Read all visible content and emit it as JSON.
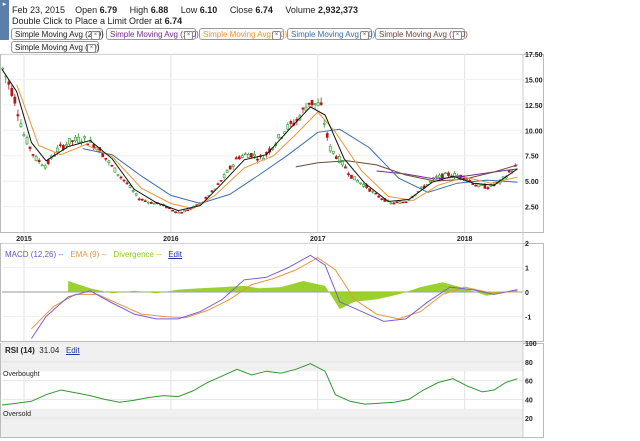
{
  "quote": {
    "date": "Feb 23, 2015",
    "open_label": "Open",
    "open": "6.79",
    "high_label": "High",
    "high": "6.88",
    "low_label": "Low",
    "low": "6.10",
    "close_label": "Close",
    "close": "6.74",
    "volume_label": "Volume",
    "volume": "2,932,373",
    "limit_order_text": "Double Click to Place a Limit Order at",
    "limit_order_price": "6.74"
  },
  "moving_averages": [
    {
      "label": "Simple Moving Avg (200)",
      "color": "#333333"
    },
    {
      "label": "Simple Moving Avg (150)",
      "color": "#7a2b9a"
    },
    {
      "label": "Simple Moving Avg (20)",
      "color": "#e8963c"
    },
    {
      "label": "Simple Moving Avg (50)",
      "color": "#3a6fb0"
    },
    {
      "label": "Simple Moving Avg (100)",
      "color": "#6b4a3a"
    },
    {
      "label": "Simple Moving Avg (10)",
      "color": "#222222"
    }
  ],
  "colors": {
    "up_candle": "#2e9a2e",
    "down_candle": "#b01818",
    "sma10": "#111111",
    "sma20": "#e8963c",
    "sma50": "#3a6fb0",
    "sma100": "#6b4a3a",
    "sma150": "#7a2b9a",
    "macd_line": "#7a5fd6",
    "macd_ema": "#e8963c",
    "macd_divergence": "#8fcc1a",
    "rsi_line": "#2e9a2e",
    "side_toggle": "#5b7fa8"
  },
  "panels": {
    "macd": {
      "label": "MACD (12,26)",
      "ema_label": "EMA (9)",
      "divergence_label": "Divergence",
      "edit": "Edit",
      "value_placeholder": "--"
    },
    "rsi": {
      "label": "RSI (14)",
      "value": "31.04",
      "edit": "Edit",
      "overbought": "Overbought",
      "oversold": "Oversold"
    }
  },
  "chart_data": [
    {
      "type": "candlestick",
      "title": "",
      "x_ticks": [
        "2015",
        "2016",
        "2017",
        "2018"
      ],
      "y_ticks": [
        "17.50",
        "15.00",
        "12.50",
        "10.00",
        "7.50",
        "5.00",
        "2.50"
      ],
      "ylim": [
        0,
        17.5
      ],
      "price_path": [
        [
          2014.85,
          16.2
        ],
        [
          2014.93,
          13.5
        ],
        [
          2015.0,
          9.5
        ],
        [
          2015.08,
          7.2
        ],
        [
          2015.15,
          6.5
        ],
        [
          2015.22,
          8.0
        ],
        [
          2015.3,
          8.8
        ],
        [
          2015.4,
          9.2
        ],
        [
          2015.5,
          8.4
        ],
        [
          2015.6,
          6.4
        ],
        [
          2015.7,
          4.8
        ],
        [
          2015.78,
          3.3
        ],
        [
          2015.86,
          2.9
        ],
        [
          2015.94,
          2.7
        ],
        [
          2016.0,
          2.2
        ],
        [
          2016.06,
          1.9
        ],
        [
          2016.14,
          2.3
        ],
        [
          2016.22,
          3.0
        ],
        [
          2016.3,
          4.2
        ],
        [
          2016.38,
          5.8
        ],
        [
          2016.46,
          7.4
        ],
        [
          2016.54,
          7.7
        ],
        [
          2016.62,
          7.2
        ],
        [
          2016.7,
          8.6
        ],
        [
          2016.78,
          10.1
        ],
        [
          2016.86,
          11.0
        ],
        [
          2016.94,
          12.8
        ],
        [
          2017.02,
          12.4
        ],
        [
          2017.08,
          8.3
        ],
        [
          2017.16,
          6.9
        ],
        [
          2017.24,
          5.3
        ],
        [
          2017.32,
          4.6
        ],
        [
          2017.4,
          3.6
        ],
        [
          2017.5,
          2.8
        ],
        [
          2017.6,
          3.0
        ],
        [
          2017.7,
          4.2
        ],
        [
          2017.8,
          5.3
        ],
        [
          2017.9,
          5.7
        ],
        [
          2018.0,
          5.4
        ],
        [
          2018.08,
          4.6
        ],
        [
          2018.16,
          4.4
        ],
        [
          2018.24,
          4.9
        ],
        [
          2018.3,
          5.8
        ],
        [
          2018.36,
          6.6
        ]
      ],
      "sma10": [
        [
          2014.85,
          16.0
        ],
        [
          2014.95,
          13.8
        ],
        [
          2015.05,
          8.8
        ],
        [
          2015.15,
          7.0
        ],
        [
          2015.3,
          8.4
        ],
        [
          2015.45,
          9.0
        ],
        [
          2015.6,
          7.2
        ],
        [
          2015.75,
          4.2
        ],
        [
          2015.9,
          2.9
        ],
        [
          2016.05,
          2.1
        ],
        [
          2016.2,
          2.6
        ],
        [
          2016.35,
          4.8
        ],
        [
          2016.5,
          7.1
        ],
        [
          2016.65,
          7.6
        ],
        [
          2016.8,
          10.0
        ],
        [
          2016.95,
          12.3
        ],
        [
          2017.05,
          11.5
        ],
        [
          2017.18,
          7.2
        ],
        [
          2017.32,
          4.8
        ],
        [
          2017.48,
          3.0
        ],
        [
          2017.62,
          3.2
        ],
        [
          2017.78,
          4.9
        ],
        [
          2017.92,
          5.5
        ],
        [
          2018.06,
          4.8
        ],
        [
          2018.2,
          4.6
        ],
        [
          2018.36,
          6.2
        ]
      ],
      "sma20": [
        [
          2014.95,
          14.5
        ],
        [
          2015.1,
          8.5
        ],
        [
          2015.25,
          7.6
        ],
        [
          2015.42,
          8.6
        ],
        [
          2015.6,
          7.4
        ],
        [
          2015.8,
          4.3
        ],
        [
          2016.0,
          2.8
        ],
        [
          2016.15,
          2.3
        ],
        [
          2016.3,
          3.6
        ],
        [
          2016.5,
          6.3
        ],
        [
          2016.7,
          7.5
        ],
        [
          2016.85,
          9.6
        ],
        [
          2017.0,
          11.8
        ],
        [
          2017.12,
          9.8
        ],
        [
          2017.3,
          6.0
        ],
        [
          2017.48,
          3.5
        ],
        [
          2017.65,
          3.1
        ],
        [
          2017.82,
          4.6
        ],
        [
          2018.0,
          5.4
        ],
        [
          2018.18,
          4.8
        ],
        [
          2018.36,
          5.4
        ]
      ],
      "sma50": [
        [
          2015.4,
          8.2
        ],
        [
          2015.6,
          7.6
        ],
        [
          2015.8,
          5.5
        ],
        [
          2016.0,
          3.6
        ],
        [
          2016.2,
          2.8
        ],
        [
          2016.4,
          3.7
        ],
        [
          2016.6,
          5.6
        ],
        [
          2016.8,
          7.6
        ],
        [
          2017.0,
          9.8
        ],
        [
          2017.15,
          10.1
        ],
        [
          2017.35,
          8.3
        ],
        [
          2017.55,
          5.3
        ],
        [
          2017.75,
          3.9
        ],
        [
          2017.95,
          4.8
        ],
        [
          2018.15,
          5.1
        ],
        [
          2018.36,
          4.9
        ]
      ],
      "sma100": [
        [
          2016.85,
          6.4
        ],
        [
          2017.0,
          6.8
        ],
        [
          2017.2,
          7.0
        ],
        [
          2017.4,
          6.6
        ],
        [
          2017.6,
          5.6
        ],
        [
          2017.8,
          5.0
        ],
        [
          2018.0,
          5.2
        ],
        [
          2018.2,
          5.9
        ],
        [
          2018.36,
          6.6
        ]
      ],
      "sma150": [
        [
          2017.4,
          6.0
        ],
        [
          2017.6,
          5.7
        ],
        [
          2017.8,
          5.2
        ],
        [
          2018.0,
          5.5
        ],
        [
          2018.2,
          5.9
        ],
        [
          2018.36,
          6.2
        ]
      ]
    },
    {
      "type": "line",
      "title": "MACD (12,26)",
      "y_ticks": [
        "2",
        "1",
        "0",
        "-1"
      ],
      "ylim": [
        -2,
        2
      ],
      "macd": [
        [
          2015.05,
          -1.9
        ],
        [
          2015.15,
          -1.0
        ],
        [
          2015.3,
          -0.2
        ],
        [
          2015.45,
          0.05
        ],
        [
          2015.6,
          -0.45
        ],
        [
          2015.75,
          -0.9
        ],
        [
          2015.9,
          -1.1
        ],
        [
          2016.05,
          -1.1
        ],
        [
          2016.2,
          -0.8
        ],
        [
          2016.35,
          -0.3
        ],
        [
          2016.5,
          0.5
        ],
        [
          2016.65,
          0.6
        ],
        [
          2016.8,
          1.0
        ],
        [
          2016.95,
          1.5
        ],
        [
          2017.05,
          1.1
        ],
        [
          2017.15,
          -0.4
        ],
        [
          2017.3,
          -0.8
        ],
        [
          2017.45,
          -1.2
        ],
        [
          2017.6,
          -1.1
        ],
        [
          2017.75,
          -0.4
        ],
        [
          2017.9,
          0.2
        ],
        [
          2018.05,
          0.1
        ],
        [
          2018.2,
          -0.1
        ],
        [
          2018.36,
          0.1
        ]
      ],
      "ema": [
        [
          2015.05,
          -1.5
        ],
        [
          2015.2,
          -0.6
        ],
        [
          2015.35,
          -0.1
        ],
        [
          2015.5,
          -0.1
        ],
        [
          2015.65,
          -0.5
        ],
        [
          2015.8,
          -0.9
        ],
        [
          2015.95,
          -1.0
        ],
        [
          2016.1,
          -1.05
        ],
        [
          2016.25,
          -0.75
        ],
        [
          2016.4,
          -0.3
        ],
        [
          2016.55,
          0.3
        ],
        [
          2016.7,
          0.55
        ],
        [
          2016.85,
          0.9
        ],
        [
          2017.0,
          1.4
        ],
        [
          2017.12,
          0.9
        ],
        [
          2017.25,
          -0.3
        ],
        [
          2017.4,
          -0.9
        ],
        [
          2017.55,
          -1.1
        ],
        [
          2017.7,
          -0.8
        ],
        [
          2017.85,
          -0.1
        ],
        [
          2018.0,
          0.2
        ],
        [
          2018.15,
          0.0
        ],
        [
          2018.36,
          0.0
        ]
      ],
      "divergence": [
        [
          2015.3,
          0.45
        ],
        [
          2015.45,
          0.15
        ],
        [
          2015.6,
          -0.05
        ],
        [
          2015.75,
          0.05
        ],
        [
          2015.9,
          -0.05
        ],
        [
          2016.05,
          0.1
        ],
        [
          2016.2,
          0.15
        ],
        [
          2016.35,
          0.2
        ],
        [
          2016.5,
          0.25
        ],
        [
          2016.6,
          0.15
        ],
        [
          2016.75,
          0.2
        ],
        [
          2016.9,
          0.45
        ],
        [
          2017.05,
          0.25
        ],
        [
          2017.15,
          -0.7
        ],
        [
          2017.25,
          -0.4
        ],
        [
          2017.4,
          -0.3
        ],
        [
          2017.55,
          -0.1
        ],
        [
          2017.7,
          0.2
        ],
        [
          2017.85,
          0.4
        ],
        [
          2018.0,
          0.15
        ],
        [
          2018.15,
          -0.15
        ],
        [
          2018.36,
          0.1
        ]
      ]
    },
    {
      "type": "line",
      "title": "RSI (14)",
      "y_ticks": [
        "100",
        "80",
        "60",
        "40",
        "20"
      ],
      "ylim": [
        0,
        100
      ],
      "overbought": 70,
      "oversold": 30,
      "rsi": [
        [
          2014.85,
          34
        ],
        [
          2014.95,
          36
        ],
        [
          2015.05,
          38
        ],
        [
          2015.15,
          45
        ],
        [
          2015.25,
          50
        ],
        [
          2015.35,
          47
        ],
        [
          2015.45,
          44
        ],
        [
          2015.55,
          40
        ],
        [
          2015.65,
          37
        ],
        [
          2015.75,
          39
        ],
        [
          2015.85,
          42
        ],
        [
          2015.95,
          44
        ],
        [
          2016.05,
          43
        ],
        [
          2016.15,
          49
        ],
        [
          2016.25,
          58
        ],
        [
          2016.35,
          65
        ],
        [
          2016.45,
          72
        ],
        [
          2016.55,
          66
        ],
        [
          2016.65,
          70
        ],
        [
          2016.75,
          68
        ],
        [
          2016.85,
          72
        ],
        [
          2016.95,
          78
        ],
        [
          2017.05,
          70
        ],
        [
          2017.12,
          45
        ],
        [
          2017.22,
          38
        ],
        [
          2017.32,
          35
        ],
        [
          2017.42,
          36
        ],
        [
          2017.52,
          37
        ],
        [
          2017.62,
          40
        ],
        [
          2017.72,
          50
        ],
        [
          2017.82,
          58
        ],
        [
          2017.92,
          62
        ],
        [
          2018.02,
          54
        ],
        [
          2018.12,
          48
        ],
        [
          2018.2,
          50
        ],
        [
          2018.28,
          58
        ],
        [
          2018.36,
          62
        ]
      ]
    }
  ]
}
